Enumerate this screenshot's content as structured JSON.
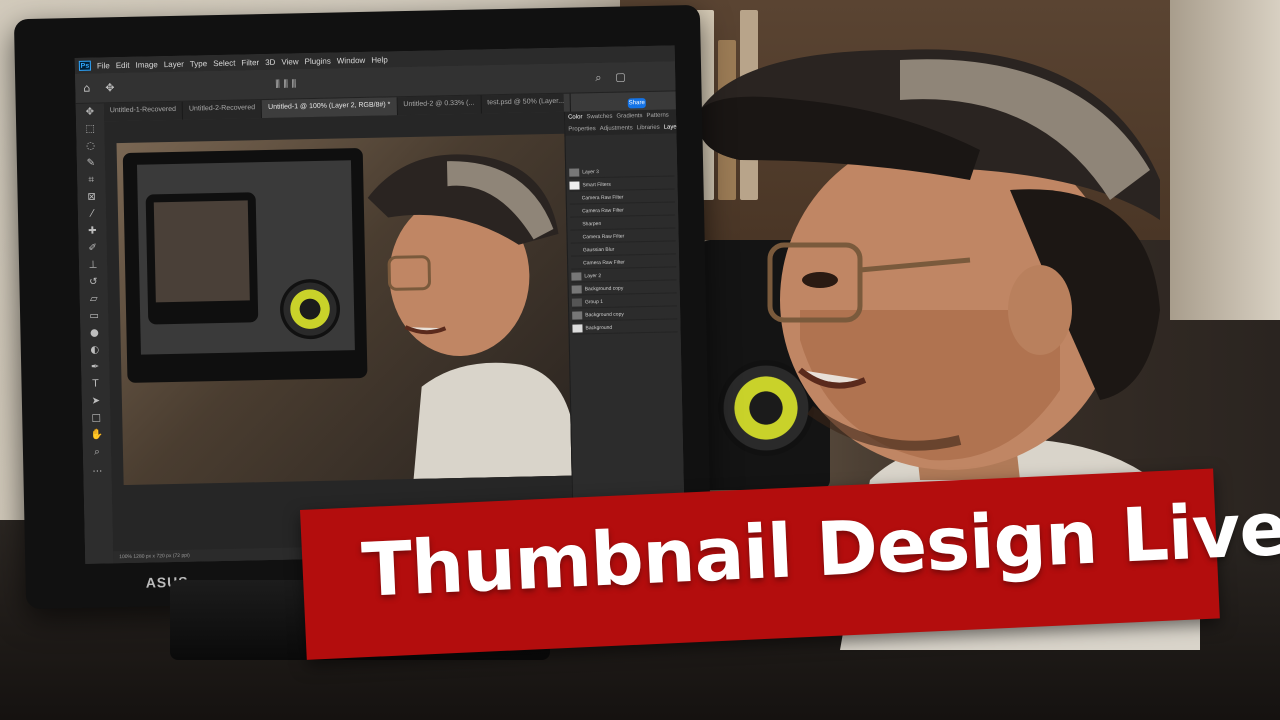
{
  "banner": {
    "title": "Thumbnail Design Live",
    "background_color": "#b30d0d",
    "text_color": "#ffffff"
  },
  "photoshop": {
    "app_logo": "Ps",
    "menu": [
      "File",
      "Edit",
      "Image",
      "Layer",
      "Type",
      "Select",
      "Filter",
      "3D",
      "View",
      "Plugins",
      "Window",
      "Help"
    ],
    "share_label": "Share",
    "tabs": [
      {
        "label": "Untitled-1-Recovered",
        "active": false
      },
      {
        "label": "Untitled-2-Recovered",
        "active": false
      },
      {
        "label": "Untitled-1 @ 100% (Layer 2, RGB/8#) *",
        "active": true
      },
      {
        "label": "Untitled-2 @ 0.33% (...",
        "active": false
      },
      {
        "label": "test.psd @ 50% (Layer...",
        "active": false
      }
    ],
    "panel_tabs": [
      {
        "label": "Color",
        "active": false
      },
      {
        "label": "Swatches",
        "active": false
      },
      {
        "label": "Gradients",
        "active": false
      },
      {
        "label": "Patterns",
        "active": false
      }
    ],
    "layers_tabs": [
      {
        "label": "Properties",
        "active": false
      },
      {
        "label": "Adjustments",
        "active": false
      },
      {
        "label": "Libraries",
        "active": false
      },
      {
        "label": "Layers",
        "active": true
      }
    ],
    "layers": [
      "Layer 3",
      "Smart Filters",
      "Camera Raw Filter",
      "Camera Raw Filter",
      "Sharpen",
      "Camera Raw Filter",
      "Gaussian Blur",
      "Camera Raw Filter",
      "Layer 2",
      "Background copy",
      "Group 1",
      "Background copy",
      "Background"
    ],
    "status": "100%   1280 px x 720 px (72 ppi)"
  },
  "monitor_brand": "ASUS",
  "icons": [
    "home-icon",
    "move-tool-icon",
    "marquee-tool-icon",
    "lasso-tool-icon",
    "crop-tool-icon",
    "eyedropper-icon",
    "brush-icon",
    "eraser-icon",
    "pen-tool-icon",
    "text-tool-icon",
    "hand-tool-icon",
    "zoom-tool-icon"
  ]
}
